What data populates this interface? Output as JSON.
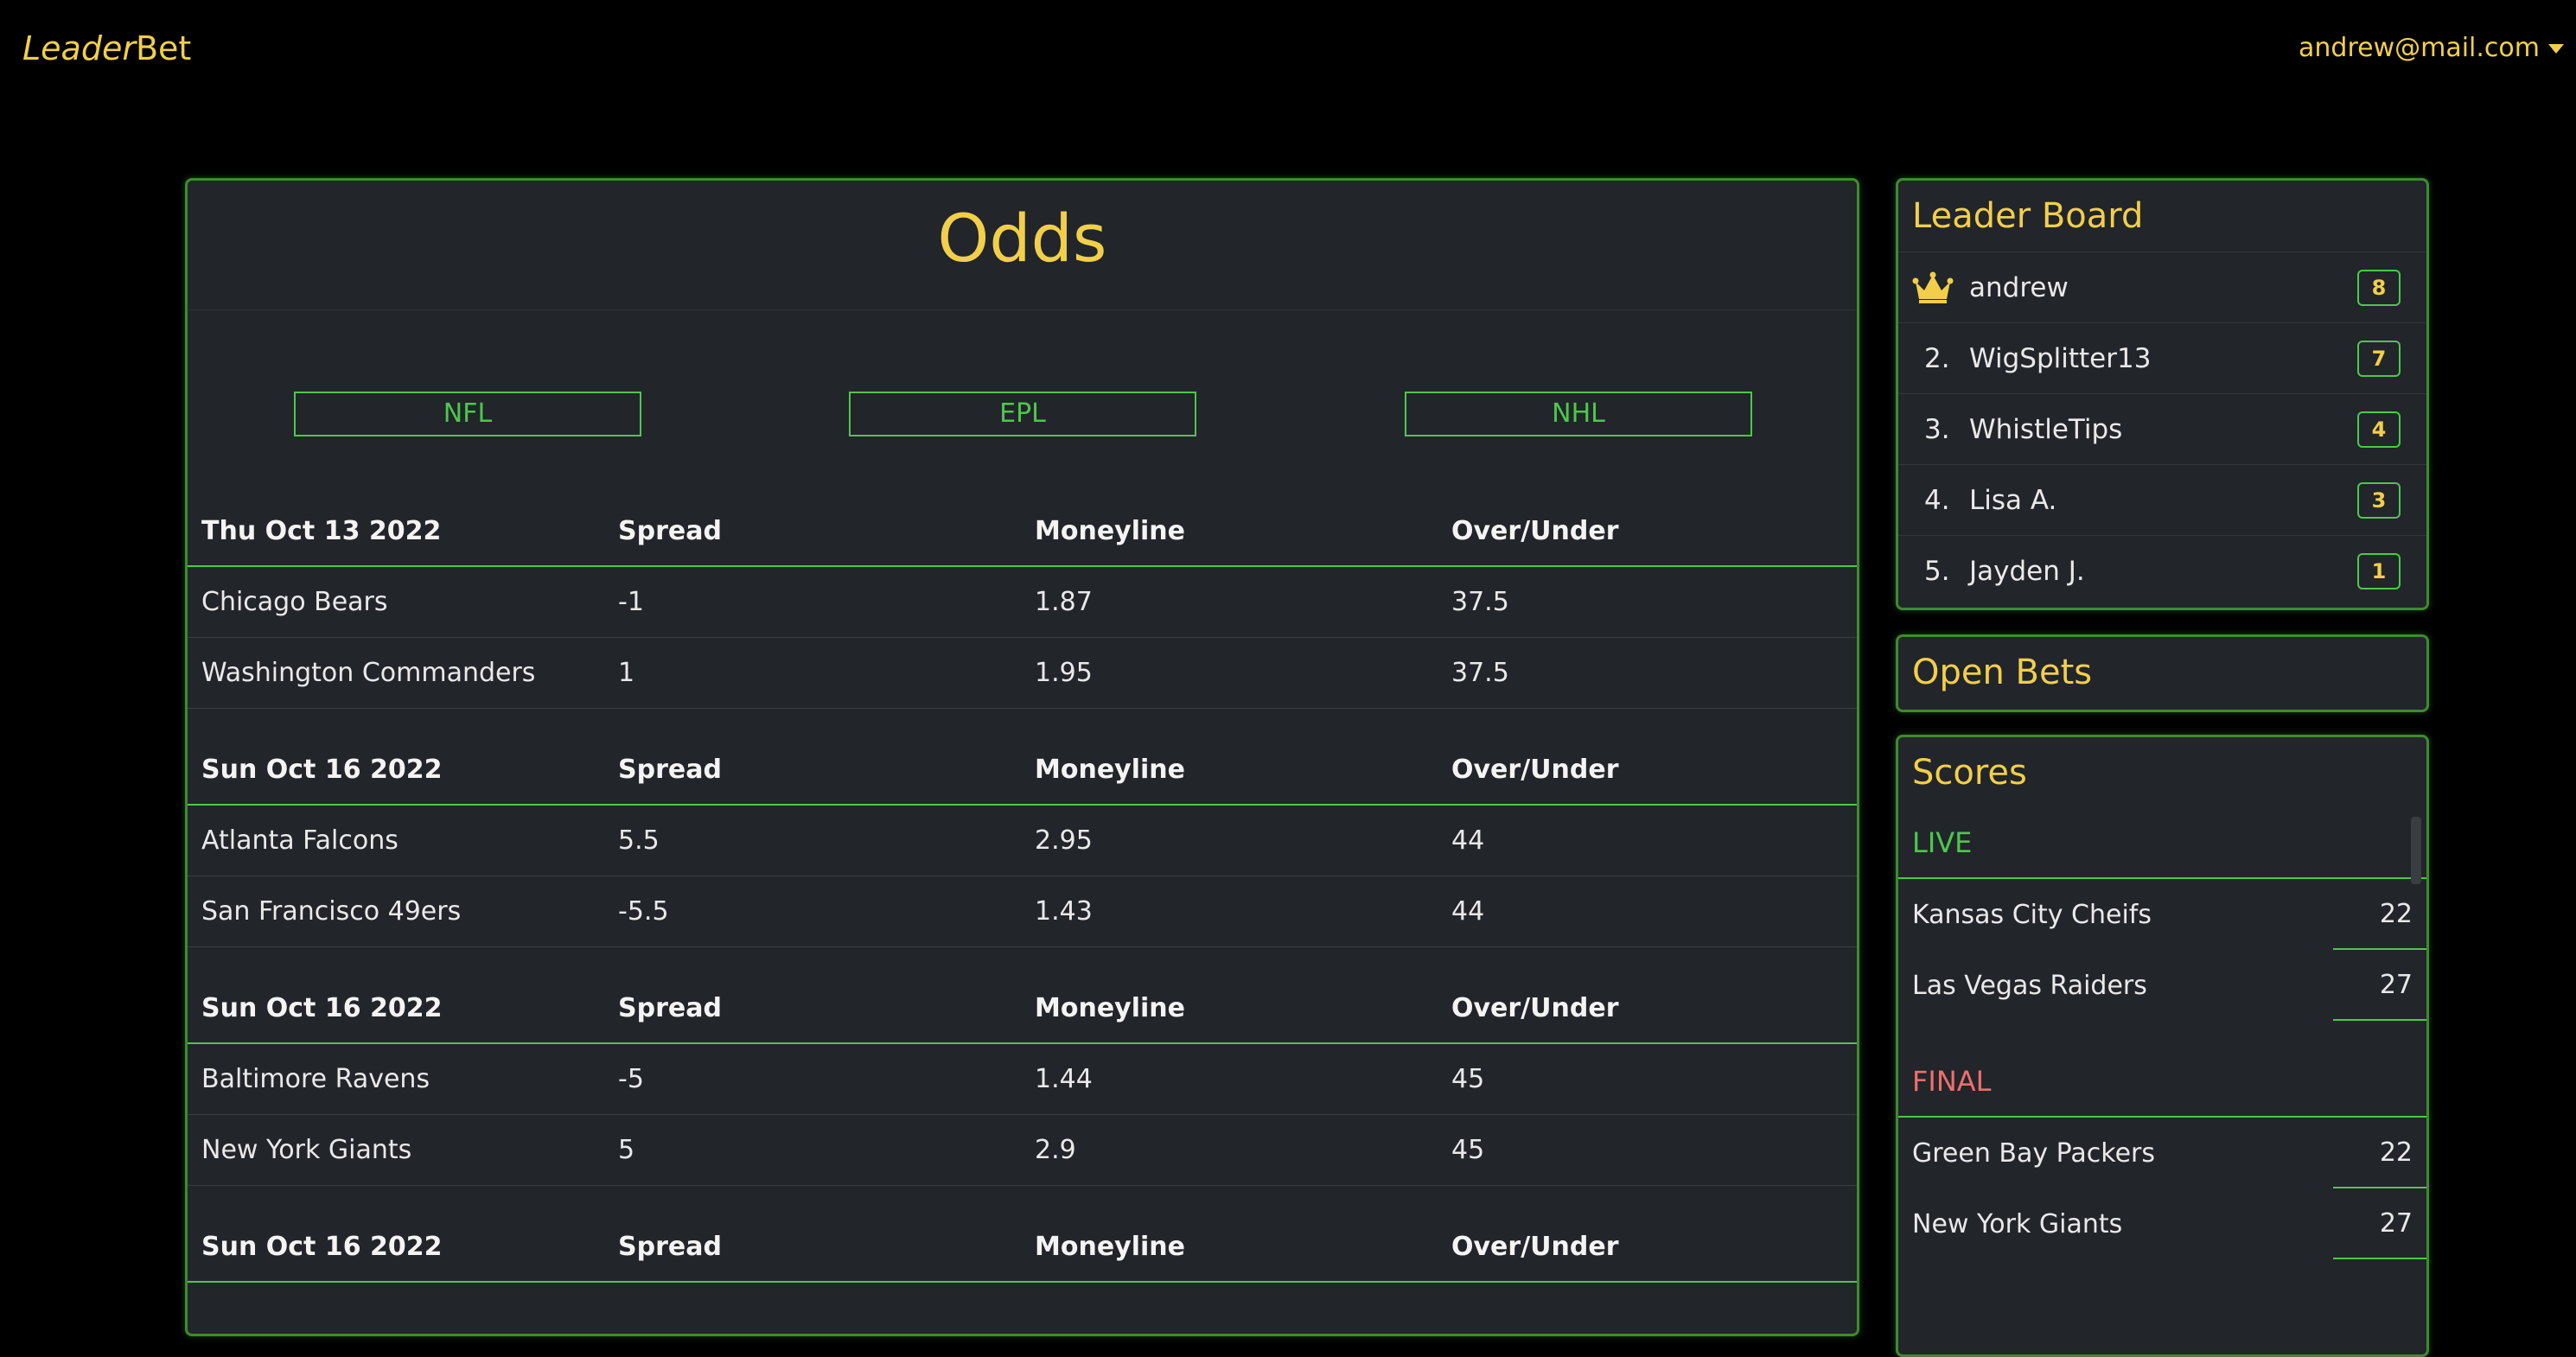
{
  "navbar": {
    "brand_part1": "Leader",
    "brand_part2": "Bet",
    "user_email": "andrew@mail.com"
  },
  "odds": {
    "title": "Odds",
    "leagues": [
      "NFL",
      "EPL",
      "NHL"
    ],
    "columns": [
      "Spread",
      "Moneyline",
      "Over/Under"
    ],
    "games": [
      {
        "date": "Thu Oct 13 2022",
        "teams": [
          {
            "name": "Chicago Bears",
            "spread": "-1",
            "moneyline": "1.87",
            "over_under": "37.5"
          },
          {
            "name": "Washington Commanders",
            "spread": "1",
            "moneyline": "1.95",
            "over_under": "37.5"
          }
        ]
      },
      {
        "date": "Sun Oct 16 2022",
        "teams": [
          {
            "name": "Atlanta Falcons",
            "spread": "5.5",
            "moneyline": "2.95",
            "over_under": "44"
          },
          {
            "name": "San Francisco 49ers",
            "spread": "-5.5",
            "moneyline": "1.43",
            "over_under": "44"
          }
        ]
      },
      {
        "date": "Sun Oct 16 2022",
        "teams": [
          {
            "name": "Baltimore Ravens",
            "spread": "-5",
            "moneyline": "1.44",
            "over_under": "45"
          },
          {
            "name": "New York Giants",
            "spread": "5",
            "moneyline": "2.9",
            "over_under": "45"
          }
        ]
      },
      {
        "date": "Sun Oct 16 2022",
        "teams": []
      }
    ]
  },
  "leaderboard": {
    "title": "Leader Board",
    "entries": [
      {
        "rank": "",
        "icon": "crown-icon",
        "name": "andrew",
        "score": "8"
      },
      {
        "rank": "2.",
        "name": "WigSplitter13",
        "score": "7"
      },
      {
        "rank": "3.",
        "name": "WhistleTips",
        "score": "4"
      },
      {
        "rank": "4.",
        "name": "Lisa A.",
        "score": "3"
      },
      {
        "rank": "5.",
        "name": "Jayden J.",
        "score": "1"
      }
    ]
  },
  "open_bets": {
    "title": "Open Bets"
  },
  "scores": {
    "title": "Scores",
    "live_label": "LIVE",
    "final_label": "FINAL",
    "live": [
      {
        "team": "Kansas City Cheifs",
        "score": "22"
      },
      {
        "team": "Las Vegas Raiders",
        "score": "27"
      }
    ],
    "final": [
      {
        "team": "Green Bay Packers",
        "score": "22"
      },
      {
        "team": "New York Giants",
        "score": "27"
      }
    ]
  },
  "colors": {
    "accent_gold": "#f2cf4a",
    "accent_green": "#4cc84c",
    "final_red": "#ef6e6e",
    "panel_bg": "#22252a"
  }
}
